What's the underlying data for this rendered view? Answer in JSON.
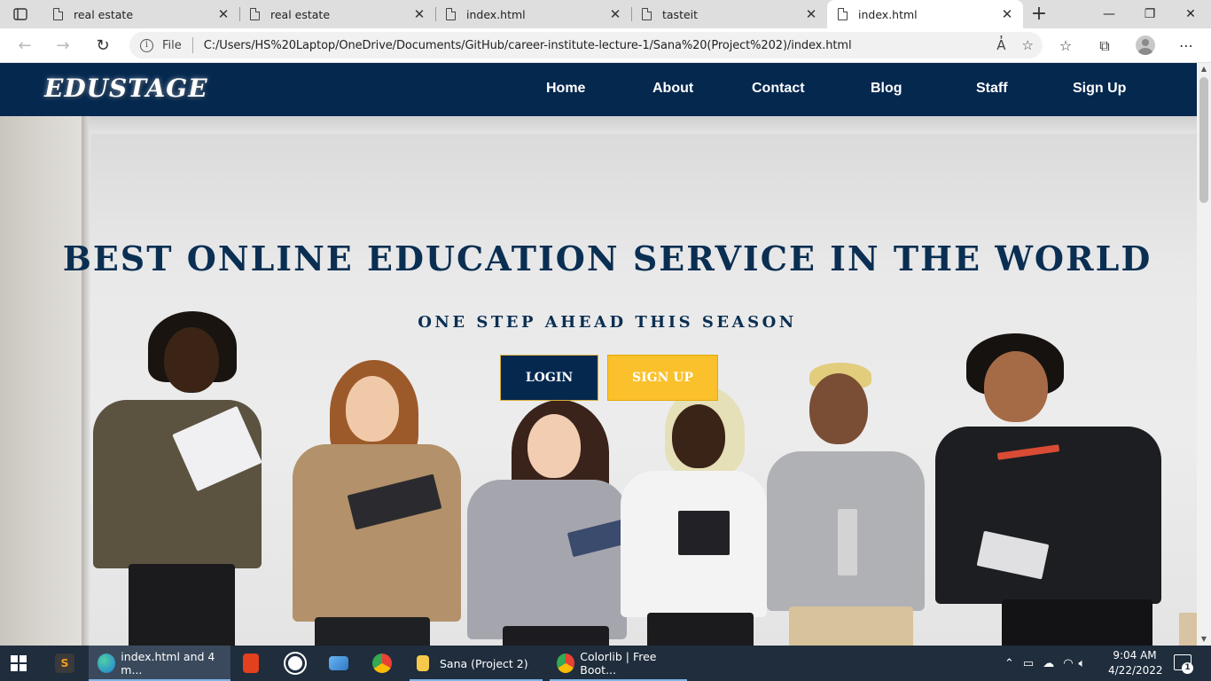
{
  "browser": {
    "tabs": [
      {
        "title": "real estate",
        "active": false
      },
      {
        "title": "real estate",
        "active": false
      },
      {
        "title": "index.html",
        "active": false
      },
      {
        "title": "tasteit",
        "active": false
      },
      {
        "title": "index.html",
        "active": true
      }
    ],
    "new_tab_symbol": "+",
    "window_controls": {
      "minimize": "—",
      "restore": "❐",
      "close": "✕"
    },
    "address_bar": {
      "scheme_label": "File",
      "url": "C:/Users/HS%20Laptop/OneDrive/Documents/GitHub/career-institute-lecture-1/Sana%20(Project%202)/index.html"
    }
  },
  "site": {
    "logo": "EDUSTAGE",
    "nav": [
      "Home",
      "About",
      "Contact",
      "Blog",
      "Staff",
      "Sign Up"
    ],
    "hero": {
      "title": "BEST ONLINE EDUCATION SERVICE IN THE WORLD",
      "subtitle": "ONE STEP AHEAD THIS SEASON",
      "login_label": "LOGIN",
      "signup_label": "SIGN UP"
    },
    "colors": {
      "navy": "#05284f",
      "gold": "#fbc12c",
      "title": "#0a2f52"
    }
  },
  "taskbar": {
    "items": [
      {
        "label": "index.html and 4 m..."
      },
      {
        "label": "Sana (Project 2)"
      },
      {
        "label": "Colorlib | Free Boot..."
      }
    ],
    "clock": {
      "time": "9:04 AM",
      "date": "4/22/2022"
    },
    "notification_count": "1"
  }
}
